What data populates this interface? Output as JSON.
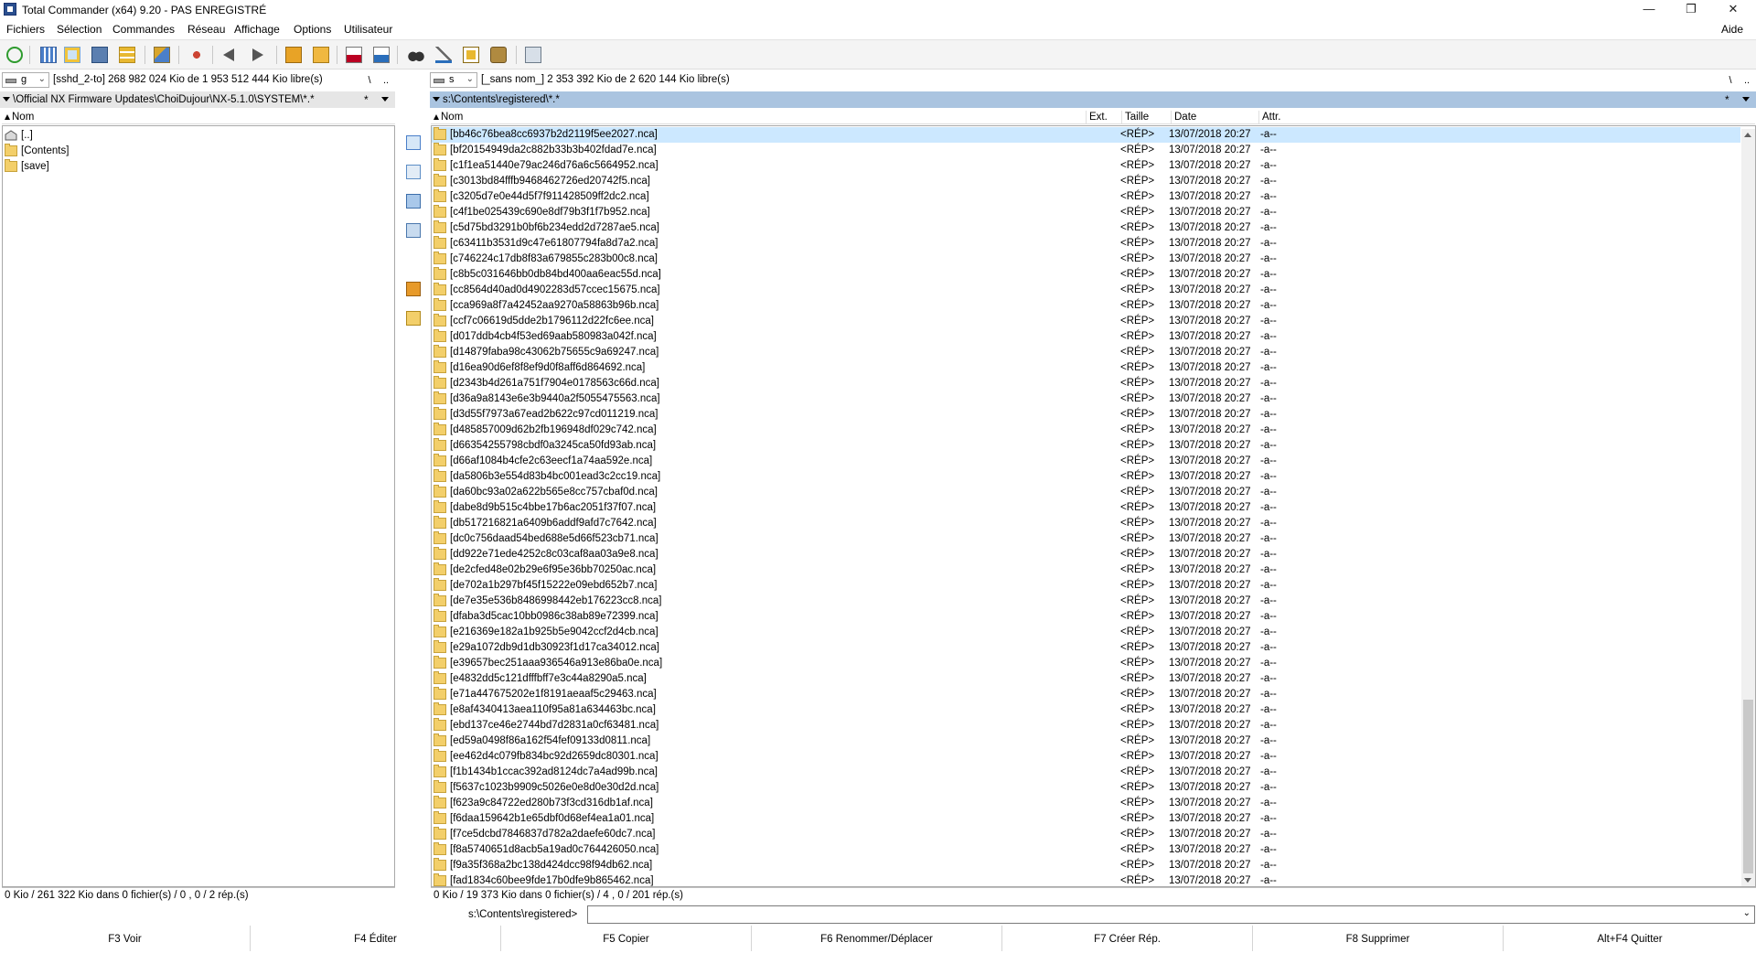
{
  "window": {
    "title": "Total Commander (x64) 9.20 - PAS ENREGISTRÉ",
    "minimize_glyph": "—",
    "maximize_glyph": "❐",
    "close_glyph": "✕"
  },
  "menu": {
    "items": [
      "Fichiers",
      "Sélection",
      "Commandes",
      "Réseau",
      "Affichage",
      "Options",
      "Utilisateur"
    ],
    "help": "Aide"
  },
  "toolbar": {
    "icons": [
      "refresh-icon",
      "brief-view-icon",
      "detailed-view-icon",
      "thumbnail-view-icon",
      "tree-view-icon",
      "sort-icon",
      "unpack-icon",
      "back-icon",
      "forward-icon",
      "pack-icon",
      "unpack-all-icon",
      "ftp-icon",
      "url-icon",
      "search-icon",
      "rename-tool-icon",
      "sync-dirs-icon",
      "network-drive-icon",
      "notepad-icon"
    ]
  },
  "left": {
    "drive": {
      "letter": "g",
      "info": "[sshd_2-to]  268 982 024 Kio de 1 953 512 444 Kio libre(s)",
      "root_btn": "\\",
      "up_btn": ".."
    },
    "path": "\\Official NX Firmware Updates\\ChoiDujour\\NX-5.1.0\\SYSTEM\\*.*",
    "star": "*",
    "header_name": "Nom",
    "rows": [
      "[..]",
      "[Contents]",
      "[save]"
    ],
    "status": "0 Kio / 261 322 Kio dans 0 fichier(s) / 0 , 0 / 2 rép.(s)"
  },
  "right": {
    "drive": {
      "letter": "s",
      "info": "[_sans nom_]  2 353 392 Kio de 2 620 144 Kio libre(s)",
      "root_btn": "\\",
      "up_btn": ".."
    },
    "path": "s:\\Contents\\registered\\*.*",
    "star": "*",
    "headers": {
      "name": "Nom",
      "ext": "Ext.",
      "size": "Taille",
      "date": "Date",
      "attr": "Attr."
    },
    "row_size": "<RÉP>",
    "row_date": "13/07/2018 20:27",
    "row_attr": "-a--",
    "rows": [
      "[bb46c76bea8cc6937b2d2119f5ee2027.nca]",
      "[bf20154949da2c882b33b3b402fdad7e.nca]",
      "[c1f1ea51440e79ac246d76a6c5664952.nca]",
      "[c3013bd84fffb9468462726ed20742f5.nca]",
      "[c3205d7e0e44d5f7f911428509ff2dc2.nca]",
      "[c4f1be025439c690e8df79b3f1f7b952.nca]",
      "[c5d75bd3291b0bf6b234edd2d7287ae5.nca]",
      "[c63411b3531d9c47e61807794fa8d7a2.nca]",
      "[c746224c17db8f83a679855c283b00c8.nca]",
      "[c8b5c031646bb0db84bd400aa6eac55d.nca]",
      "[cc8564d40ad0d4902283d57ccec15675.nca]",
      "[cca969a8f7a42452aa9270a58863b96b.nca]",
      "[ccf7c06619d5dde2b1796112d22fc6ee.nca]",
      "[d017ddb4cb4f53ed69aab580983a042f.nca]",
      "[d14879faba98c43062b75655c9a69247.nca]",
      "[d16ea90d6ef8f8ef9d0f8aff6d864692.nca]",
      "[d2343b4d261a751f7904e0178563c66d.nca]",
      "[d36a9a8143e6e3b9440a2f5055475563.nca]",
      "[d3d55f7973a67ead2b622c97cd011219.nca]",
      "[d485857009d62b2fb196948df029c742.nca]",
      "[d66354255798cbdf0a3245ca50fd93ab.nca]",
      "[d66af1084b4cfe2c63eecf1a74aa592e.nca]",
      "[da5806b3e554d83b4bc001ead3c2cc19.nca]",
      "[da60bc93a02a622b565e8cc757cbaf0d.nca]",
      "[dabe8d9b515c4bbe17b6ac2051f37f07.nca]",
      "[db517216821a6409b6addf9afd7c7642.nca]",
      "[dc0c756daad54bed688e5d66f523cb71.nca]",
      "[dd922e71ede4252c8c03caf8aa03a9e8.nca]",
      "[de2cfed48e02b29e6f95e36bb70250ac.nca]",
      "[de702a1b297bf45f15222e09ebd652b7.nca]",
      "[de7e35e536b8486998442eb176223cc8.nca]",
      "[dfaba3d5cac10bb0986c38ab89e72399.nca]",
      "[e216369e182a1b925b5e9042ccf2d4cb.nca]",
      "[e29a1072db9d1db30923f1d17ca34012.nca]",
      "[e39657bec251aaa936546a913e86ba0e.nca]",
      "[e4832dd5c121dfffbff7e3c44a8290a5.nca]",
      "[e71a447675202e1f8191aeaaf5c29463.nca]",
      "[e8af4340413aea110f95a81a634463bc.nca]",
      "[ebd137ce46e2744bd7d2831a0cf63481.nca]",
      "[ed59a0498f86a162f54fef09133d0811.nca]",
      "[ee462d4c079fb834bc92d2659dc80301.nca]",
      "[f1b1434b1ccac392ad8124dc7a4ad99b.nca]",
      "[f5637c1023b9909c5026e0e8d0e30d2d.nca]",
      "[f623a9c84722ed280b73f3cd316db1af.nca]",
      "[f6daa159642b1e65dbf0d68ef4ea1a01.nca]",
      "[f7ce5dcbd7846837d782a2daefe60dc7.nca]",
      "[f8a5740651d8acb5a19ad0c764426050.nca]",
      "[f9a35f368a2bc138d424dcc98f94db62.nca]",
      "[fad1834c60bee9fde17b0dfe9b865462.nca]"
    ],
    "selected_index": 0,
    "status": "0 Kio / 19 373 Kio dans 0 fichier(s) / 4 , 0 / 201 rép.(s)",
    "scroll_position_fraction": 1.0
  },
  "command_line": {
    "label": "s:\\Contents\\registered>",
    "value": ""
  },
  "function_keys": [
    "F3 Voir",
    "F4 Éditer",
    "F5 Copier",
    "F6 Renommer/Déplacer",
    "F7 Créer Rép.",
    "F8 Supprimer",
    "Alt+F4 Quitter"
  ],
  "colors": {
    "active_path_bg": "#aac4e0",
    "inactive_path_bg": "#e6e6e6",
    "selection_bg": "#cce8ff",
    "folder_yellow": "#f3cf6a"
  }
}
